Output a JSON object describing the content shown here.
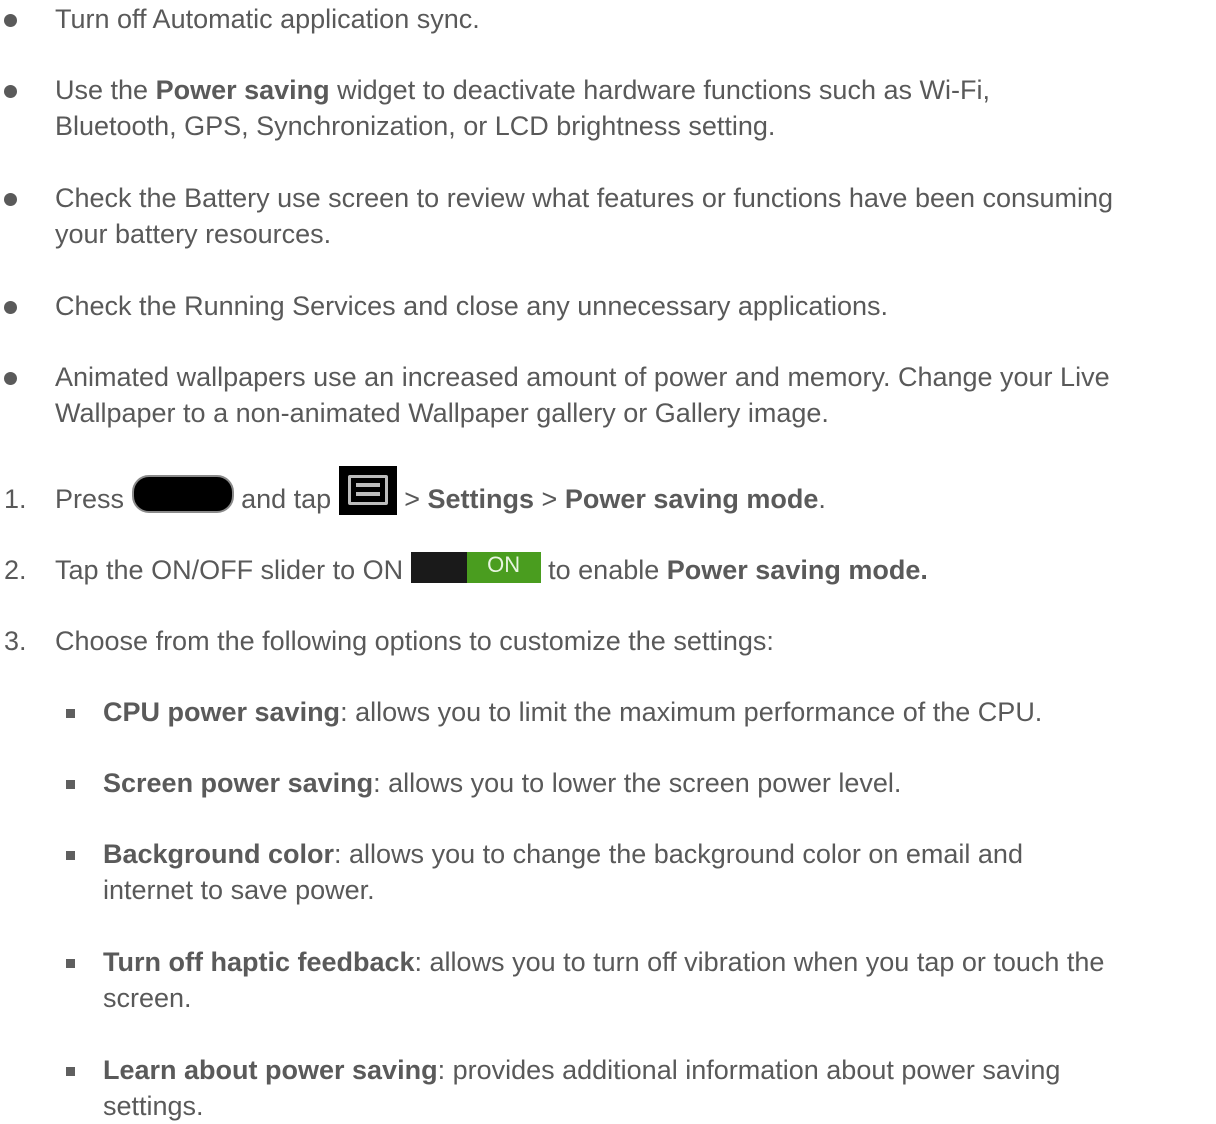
{
  "bullets": [
    {
      "text": "Turn off Automatic application sync."
    },
    {
      "pre": "Use the ",
      "bold": "Power saving",
      "post_line1": " widget to deactivate hardware functions such as Wi-Fi,",
      "line2": "Bluetooth, GPS, Synchronization, or LCD brightness setting."
    },
    {
      "line1": "Check the Battery use screen to review what features or functions have been consuming",
      "line2": "your battery resources."
    },
    {
      "text": "Check the Running Services and close any unnecessary applications."
    },
    {
      "line1": "Animated wallpapers use an increased amount of power and memory. Change your Live",
      "line2": "Wallpaper to a non-animated Wallpaper gallery or Gallery image."
    }
  ],
  "steps": [
    {
      "number": "1.",
      "press": "Press",
      "and_tap": "and tap",
      "gt1": ">",
      "settings": "Settings",
      "gt2": ">",
      "power_saving_mode": "Power saving mode",
      "period": ".",
      "home_icon": "home-key-icon",
      "menu_icon": "menu-key-icon"
    },
    {
      "number": "2.",
      "pre": "Tap the ON/OFF slider to ON",
      "toggle_label": "ON",
      "mid": "to enable",
      "bold": "Power saving mode.",
      "toggle_color": "#4a9d1f"
    },
    {
      "number": "3.",
      "text": "Choose from the following options to customize the settings:"
    }
  ],
  "options": [
    {
      "bold": "CPU power saving",
      "line1": ": allows you to limit the maximum performance of the CPU."
    },
    {
      "bold": "Screen power saving",
      "line1": ": allows you to lower the screen power level."
    },
    {
      "bold": "Background color",
      "line1": ": allows you to change the background color on email and",
      "line2": "internet to save power."
    },
    {
      "bold": "Turn off haptic feedback",
      "line1": ": allows you to turn off vibration when you tap or touch the",
      "line2": "screen."
    },
    {
      "bold": "Learn about power saving",
      "line1": ": provides additional information about power saving",
      "line2": "settings."
    }
  ]
}
